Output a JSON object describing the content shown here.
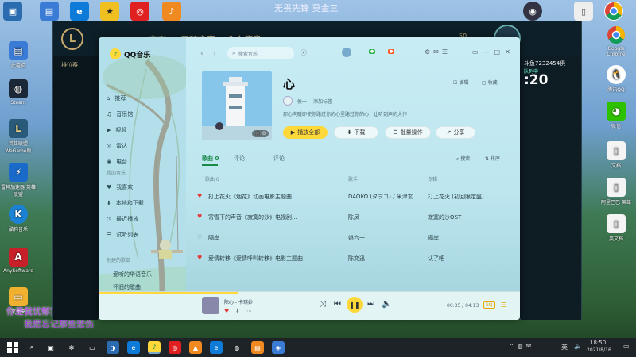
{
  "desktop": {
    "top_center_text": "无畏先锋 莫金三",
    "icons_left": [
      {
        "label": "此电脑",
        "icon": "pc-icon",
        "color": "#3a7bd5"
      },
      {
        "label": "此电脑",
        "icon": "pc-icon",
        "color": "#3a7bd5"
      },
      {
        "label": "文档",
        "icon": "folder-icon",
        "color": "#e0a020"
      },
      {
        "label": "Steam",
        "icon": "steam-icon",
        "color": "#1b2838"
      },
      {
        "label": "英雄联盟 WeGame版",
        "icon": "lol-icon",
        "color": "#2a5a7a"
      },
      {
        "label": "雷神加速器 英雄联盟",
        "icon": "game-icon",
        "color": "#1a6aca"
      },
      {
        "label": "酷狗音乐",
        "icon": "kugou-icon",
        "color": "#1b82d6"
      },
      {
        "label": "AnySoftware",
        "icon": "app-icon",
        "color": "#c8202a"
      },
      {
        "label": "文件夹",
        "icon": "folder-icon",
        "color": "#f0b030"
      }
    ],
    "icons_right": [
      {
        "label": "Google Chrome",
        "icon": "chrome-icon"
      },
      {
        "label": "腾讯QQ",
        "icon": "qq-icon"
      },
      {
        "label": "微信",
        "icon": "wechat-icon"
      },
      {
        "label": "文档",
        "icon": "doc-icon"
      },
      {
        "label": "阿里巴巴 英雄",
        "icon": "doc-icon"
      },
      {
        "label": "英文档",
        "icon": "doc-icon"
      }
    ],
    "overlay_text_1": "你是我忧郁梦魇的天使",
    "overlay_text_2": "我愿忘记那些悲伤",
    "right_panel_title": "斗鱼7232454俱一",
    "right_panel_sub": "队列中",
    "right_panel_time": ":20"
  },
  "lol": {
    "nav": [
      "主页",
      "云顶之弈",
      "个人信息"
    ],
    "currency": "50",
    "side_label": "排位赛"
  },
  "qq": {
    "brand": "QQ音乐",
    "search_placeholder": "搜索音乐",
    "playlist": {
      "title": "心",
      "creator": "侯一",
      "creator_action": "添加标签",
      "desc": "那心向暖即使你路过你的心里路过你的心，让听到声的大作",
      "play_all": "播放全部",
      "play_count": "0",
      "download": "下载",
      "batch": "批量操作",
      "share": "分享",
      "edit": "编辑",
      "collect": "收藏"
    },
    "sidebar": {
      "top": [
        "推荐",
        "音乐馆",
        "视频",
        "雷达",
        "电台"
      ],
      "mine_header": "我的音乐",
      "mine": [
        "我喜欢",
        "本地和下载",
        "最近播放",
        "试听列表"
      ],
      "created_header": "创建的歌单",
      "created": [
        "爱听的华语音乐",
        "怀旧的歌曲"
      ]
    },
    "tabs": [
      "歌曲",
      "评论",
      "评论"
    ],
    "tab_count": "0",
    "search_label": "搜索",
    "sort_label": "排序",
    "columns": {
      "song": "歌曲 0",
      "artist": "歌手",
      "album": "专辑"
    },
    "songs": [
      {
        "title": "打上花火《烟花》动画电影主题曲",
        "artist": "DAOKO (ダヲコ) / 米津玄...",
        "album": "打上花火 (初回限定盤)",
        "liked": true
      },
      {
        "title": "寄雪下的声音《寂寞的沙》电视剧...",
        "artist": "陈凤",
        "album": "寂寞的沙OST",
        "liked": true
      },
      {
        "title": "隔岸",
        "artist": "姚六一",
        "album": "隔岸",
        "liked": false
      },
      {
        "title": "爱情转移《爱情呼叫转移》电影主题曲",
        "artist": "陈奕迅",
        "album": "认了吧",
        "liked": true
      }
    ],
    "player": {
      "now_playing": "陈心 - 卡琪妙",
      "time": "00:35 / 04:13",
      "quality": "SQ"
    }
  },
  "taskbar": {
    "time": "18:50",
    "date": "2021/8/16",
    "lang": "英"
  }
}
